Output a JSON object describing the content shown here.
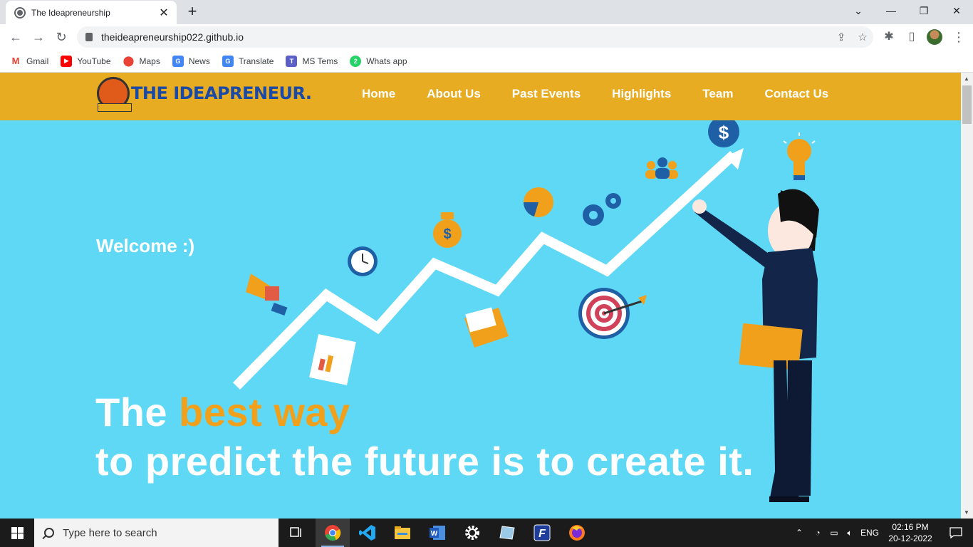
{
  "browser": {
    "tab_title": "The Ideapreneurship",
    "url": "theideapreneurship022.github.io",
    "bookmarks": [
      {
        "label": "Gmail",
        "icon": "gmail-icon",
        "color": "#ea4335"
      },
      {
        "label": "YouTube",
        "icon": "youtube-icon",
        "color": "#ff0000"
      },
      {
        "label": "Maps",
        "icon": "maps-icon",
        "color": "#34a853"
      },
      {
        "label": "News",
        "icon": "news-icon",
        "color": "#4285f4"
      },
      {
        "label": "Translate",
        "icon": "translate-icon",
        "color": "#4285f4"
      },
      {
        "label": "MS Tems",
        "icon": "teams-icon",
        "color": "#5b5fc7"
      },
      {
        "label": "Whats app",
        "icon": "whatsapp-icon",
        "color": "#25d366"
      }
    ]
  },
  "site": {
    "logo_text": "THE IDEAPRENEUR.",
    "nav": [
      "Home",
      "About Us",
      "Past Events",
      "Highlights",
      "Team",
      "Contact Us"
    ],
    "welcome": "Welcome :)",
    "tagline_prefix": "The ",
    "tagline_highlight": "best way",
    "tagline_rest": "to predict the future is to create it.",
    "colors": {
      "nav_bg": "#e8ac22",
      "hero_bg": "#5fd8f5",
      "highlight": "#f1a01c",
      "logo": "#1a4aa6"
    }
  },
  "taskbar": {
    "search_placeholder": "Type here to search",
    "lang": "ENG",
    "time": "02:16 PM",
    "date": "20-12-2022"
  }
}
